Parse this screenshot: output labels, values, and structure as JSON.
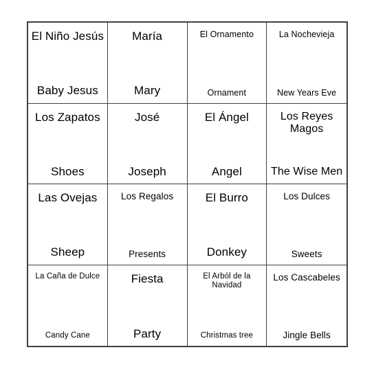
{
  "card": {
    "rows": [
      [
        {
          "term": "El Niño Jesús",
          "translation": "Baby Jesus",
          "term_size": "fs-xl",
          "translation_size": "fs-xl"
        },
        {
          "term": "María",
          "translation": "Mary",
          "term_size": "fs-xl",
          "translation_size": "fs-xl"
        },
        {
          "term": "El Ornamento",
          "translation": "Ornament",
          "term_size": "fs-sm",
          "translation_size": "fs-sm"
        },
        {
          "term": "La Nochevieja",
          "translation": "New Years Eve",
          "term_size": "fs-sm",
          "translation_size": "fs-sm"
        }
      ],
      [
        {
          "term": "Los Zapatos",
          "translation": "Shoes",
          "term_size": "fs-xl",
          "translation_size": "fs-xl"
        },
        {
          "term": "José",
          "translation": "Joseph",
          "term_size": "fs-xl",
          "translation_size": "fs-xl"
        },
        {
          "term": "El Ángel",
          "translation": "Angel",
          "term_size": "fs-xl",
          "translation_size": "fs-xl"
        },
        {
          "term": "Los Reyes Magos",
          "translation": "The Wise Men",
          "term_size": "fs-lg",
          "translation_size": "fs-lg"
        }
      ],
      [
        {
          "term": "Las Ovejas",
          "translation": "Sheep",
          "term_size": "fs-xl",
          "translation_size": "fs-xl"
        },
        {
          "term": "Los Regalos",
          "translation": "Presents",
          "term_size": "fs-md",
          "translation_size": "fs-md"
        },
        {
          "term": "El Burro",
          "translation": "Donkey",
          "term_size": "fs-xl",
          "translation_size": "fs-xl"
        },
        {
          "term": "Los Dulces",
          "translation": "Sweets",
          "term_size": "fs-md",
          "translation_size": "fs-md"
        }
      ],
      [
        {
          "term": "La Caña de Dulce",
          "translation": "Candy Cane",
          "term_size": "fs-xs",
          "translation_size": "fs-xs"
        },
        {
          "term": "Fiesta",
          "translation": "Party",
          "term_size": "fs-xl",
          "translation_size": "fs-xl"
        },
        {
          "term": "El Arból de la Navidad",
          "translation": "Christmas tree",
          "term_size": "fs-xs",
          "translation_size": "fs-xs"
        },
        {
          "term": "Los Cascabeles",
          "translation": "Jingle Bells",
          "term_size": "fs-md",
          "translation_size": "fs-md"
        }
      ]
    ]
  },
  "colors": {
    "border": "#404040",
    "background": "#ffffff",
    "text": "#000000"
  }
}
